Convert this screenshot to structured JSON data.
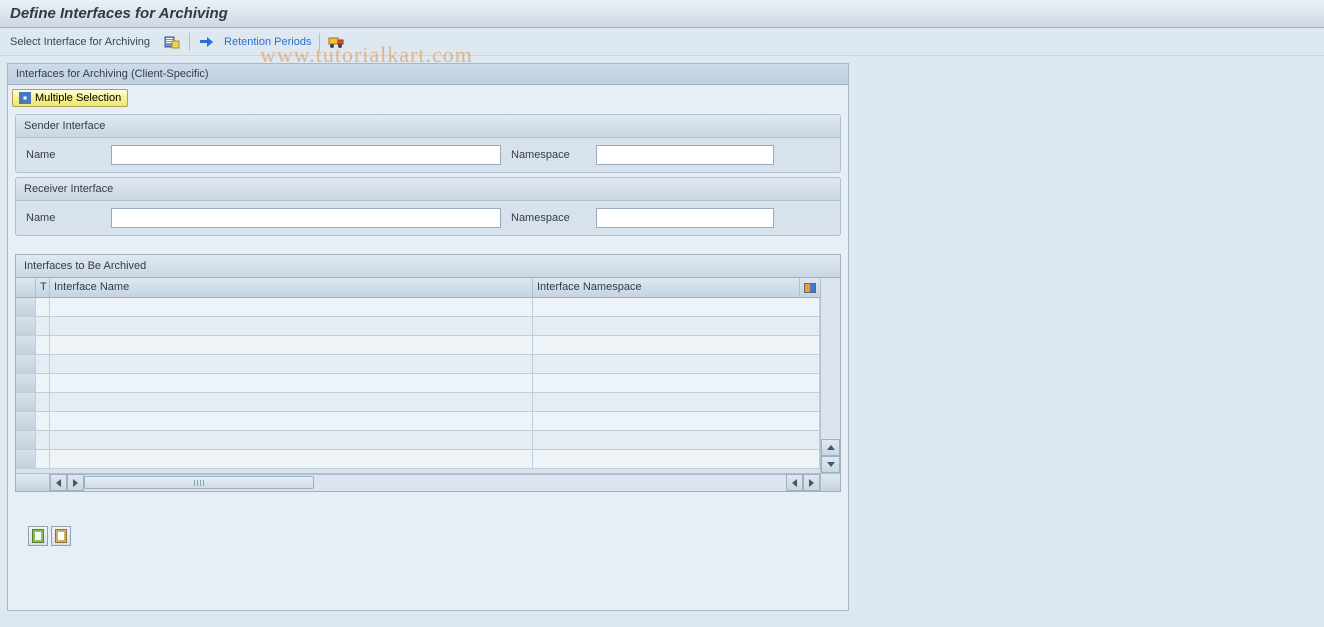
{
  "header": {
    "title": "Define Interfaces for Archiving"
  },
  "toolbar": {
    "select_label": "Select Interface for Archiving",
    "retention_label": "Retention Periods"
  },
  "watermark": "www.tutorialkart.com",
  "panel": {
    "title": "Interfaces for Archiving (Client-Specific)",
    "multiple_selection_label": "Multiple Selection",
    "sender": {
      "title": "Sender Interface",
      "name_label": "Name",
      "name_value": "",
      "namespace_label": "Namespace",
      "namespace_value": ""
    },
    "receiver": {
      "title": "Receiver Interface",
      "name_label": "Name",
      "name_value": "",
      "namespace_label": "Namespace",
      "namespace_value": ""
    },
    "table": {
      "title": "Interfaces to Be Archived",
      "col_t": "T",
      "col_name": "Interface Name",
      "col_ns": "Interface Namespace",
      "rows": [
        "",
        "",
        "",
        "",
        "",
        "",
        "",
        "",
        ""
      ]
    }
  }
}
